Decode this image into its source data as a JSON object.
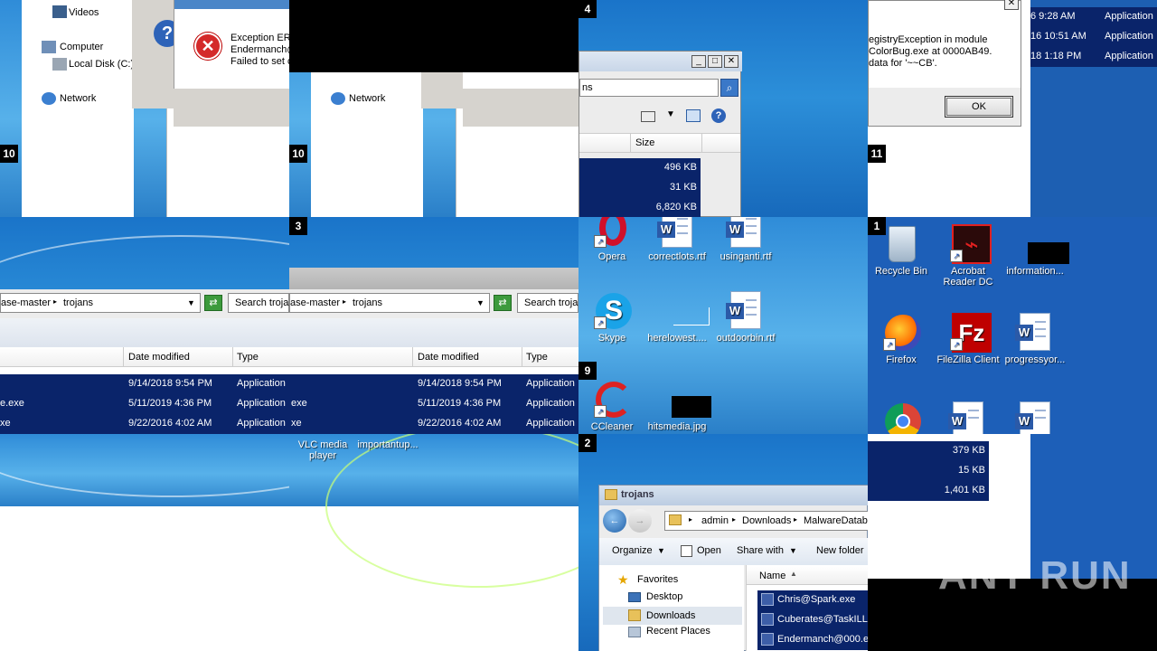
{
  "tiles": {
    "t1": {
      "num": "10",
      "nav": {
        "videos": "Videos",
        "computer": "Computer",
        "local_disk": "Local Disk (C:)",
        "network": "Network"
      },
      "dialog": {
        "line1": "Exception ER",
        "line2": "Endermanch@",
        "line3": "Failed to set c"
      }
    },
    "t2": {
      "num": "10",
      "nav": {
        "network": "Network"
      }
    },
    "t3": {
      "num": "4",
      "search_value": "ns",
      "col_size": "Size",
      "sizes": [
        "496 KB",
        "31 KB",
        "6,820 KB"
      ]
    },
    "t4": {
      "num": "11",
      "message": {
        "line1": "egistryException in module",
        "line2": "ColorBug.exe at 0000AB49.",
        "line3": "data for '~~CB'."
      },
      "ok_label": "OK",
      "list": [
        {
          "date": "6 9:28 AM",
          "type": "Application"
        },
        {
          "date": "16 10:51 AM",
          "type": "Application"
        },
        {
          "date": "18 1:18 PM",
          "type": "Application"
        }
      ]
    },
    "t5": {
      "breadcrumb": {
        "root": "ase-master",
        "folder": "trojans"
      },
      "search_placeholder": "Search troja",
      "cols": {
        "date": "Date modified",
        "type": "Type"
      },
      "rows": [
        {
          "name": "",
          "date": "9/14/2018 9:54 PM",
          "type": "Application"
        },
        {
          "name": "e.exe",
          "date": "5/11/2019 4:36 PM",
          "type": "Application"
        },
        {
          "name": "xe",
          "date": "9/22/2016 4:02 AM",
          "type": "Application"
        }
      ]
    },
    "t6": {
      "num": "3",
      "breadcrumb": {
        "root": "ase-master",
        "folder": "trojans"
      },
      "search_placeholder": "Search troja",
      "cols": {
        "date": "Date modified",
        "type": "Type"
      },
      "rows": [
        {
          "name": "",
          "date": "9/14/2018 9:54 PM",
          "type": "Application"
        },
        {
          "name": "exe",
          "date": "5/11/2019 4:36 PM",
          "type": "Application"
        },
        {
          "name": "xe",
          "date": "9/22/2016 4:02 AM",
          "type": "Application"
        }
      ]
    },
    "t7": {
      "num": "9",
      "icons": {
        "opera": "Opera",
        "correctlots": "correctlots.rtf",
        "usinganti": "usinganti.rtf",
        "skype": "Skype",
        "herelowest": "herelowest....",
        "outdoorbin": "outdoorbin.rtf",
        "ccleaner": "CCleaner",
        "hitsmedia": "hitsmedia.jpg"
      }
    },
    "t8": {
      "num": "1",
      "icons": {
        "recycle": "Recycle Bin",
        "acrobat": "Acrobat Reader DC",
        "information": "information...",
        "firefox": "Firefox",
        "filezilla": "FileZilla Client",
        "progress": "progressyor..."
      }
    },
    "t9": {
      "icons": {
        "vlc": "VLC media player",
        "important": "importantup..."
      }
    },
    "t11": {
      "num": "2",
      "title": "trojans",
      "breadcrumb": {
        "admin": "admin",
        "downloads": "Downloads",
        "malware": "MalwareDatab"
      },
      "toolbar": {
        "organize": "Organize",
        "open": "Open",
        "share": "Share with",
        "new_folder": "New folder"
      },
      "nav": {
        "favorites": "Favorites",
        "desktop": "Desktop",
        "downloads": "Downloads",
        "recent": "Recent Places"
      },
      "col_name": "Name",
      "files": [
        "Chris@Spark.exe",
        "Cuberates@TaskILL",
        "Endermanch@000.e"
      ]
    },
    "t12": {
      "sizes": [
        "379 KB",
        "15 KB",
        "1,401 KB"
      ]
    }
  },
  "watermark": "ANY RUN",
  "colors": {
    "selection": "#0a246a",
    "desktop": "#1a74c9"
  }
}
